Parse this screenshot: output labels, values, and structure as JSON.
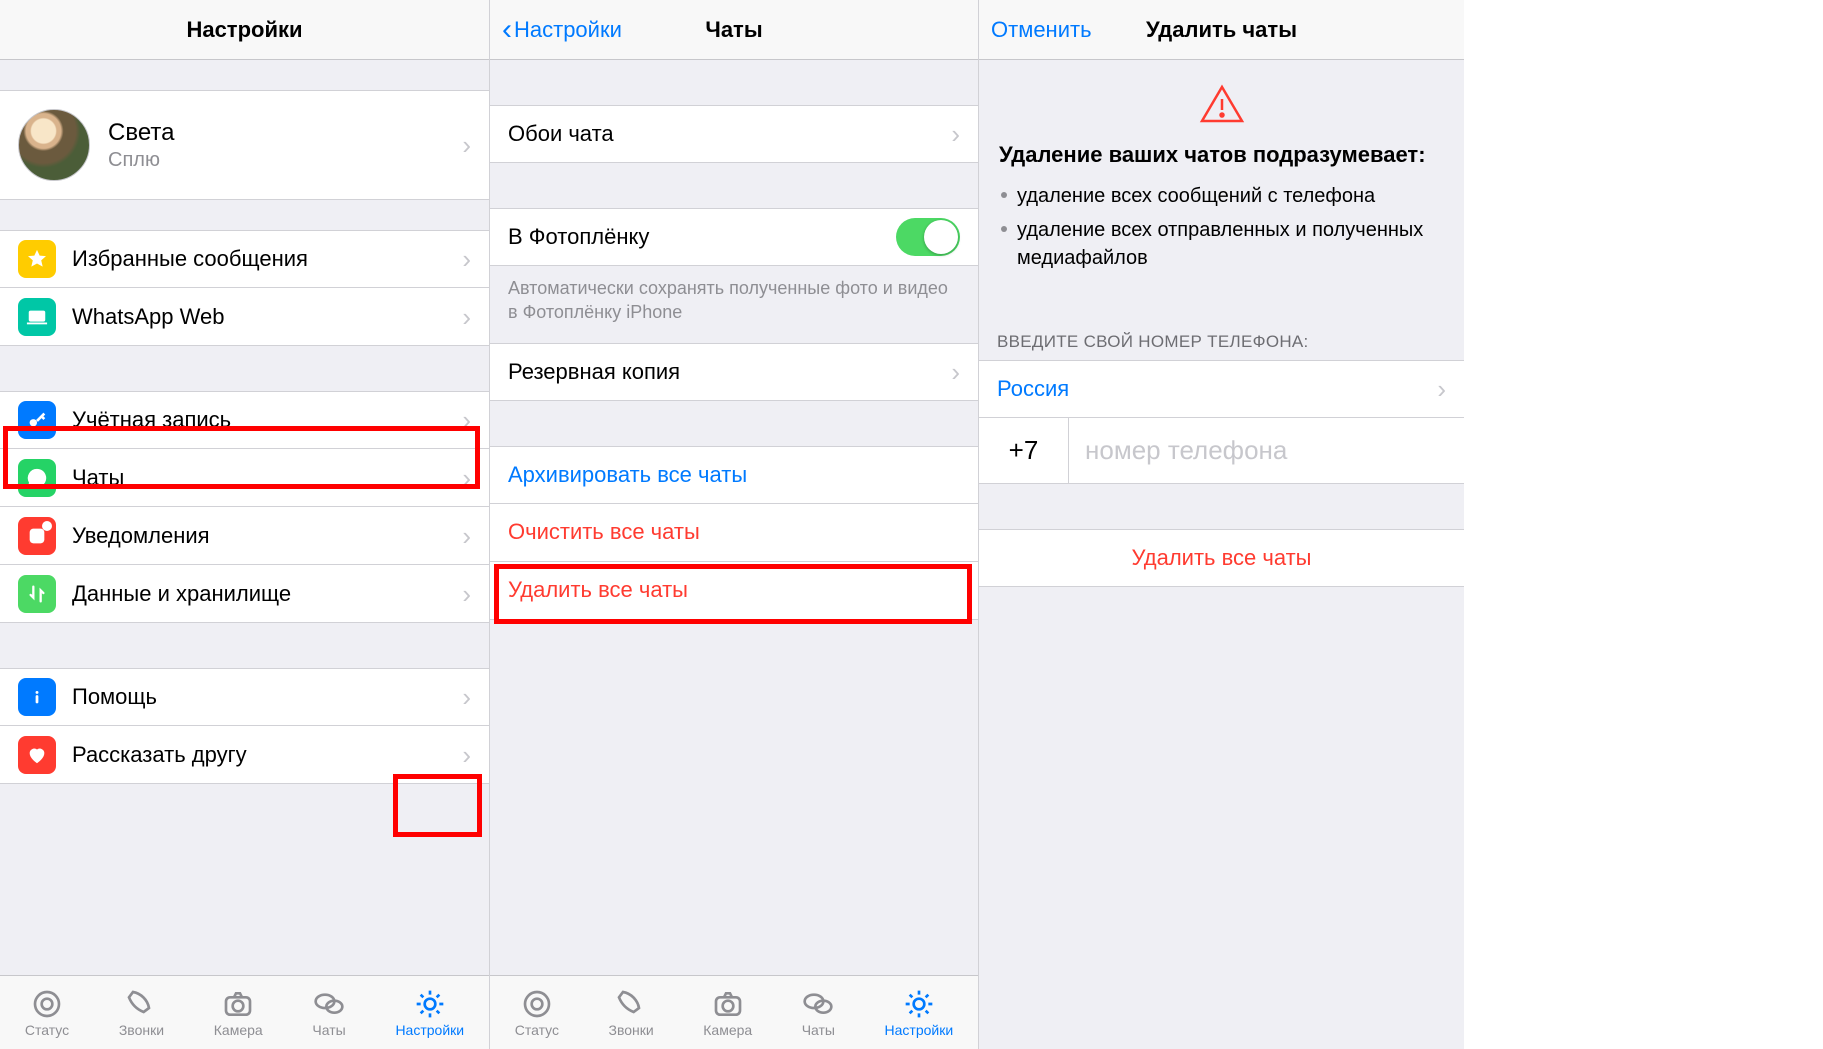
{
  "panel1": {
    "nav_title": "Настройки",
    "profile": {
      "name": "Света",
      "status": "Сплю"
    },
    "rows": {
      "starred": "Избранные сообщения",
      "web": "WhatsApp Web",
      "account": "Учётная запись",
      "chats": "Чаты",
      "notifications": "Уведомления",
      "data": "Данные и хранилище",
      "help": "Помощь",
      "tell": "Рассказать другу"
    }
  },
  "panel2": {
    "back": "Настройки",
    "title": "Чаты",
    "rows": {
      "wallpaper": "Обои чата",
      "camera_roll": "В Фотоплёнку",
      "camera_roll_footer": "Автоматически сохранять полученные фото и видео в Фотоплёнку iPhone",
      "backup": "Резервная копия",
      "archive_all": "Архивировать все чаты",
      "clear_all": "Очистить все чаты",
      "delete_all": "Удалить все чаты"
    }
  },
  "panel3": {
    "cancel": "Отменить",
    "title": "Удалить чаты",
    "heading": "Удаление ваших чатов подразумевает:",
    "bullet1": "удаление всех сообщений с телефона",
    "bullet2": "удаление всех отправленных и полученных медиафайлов",
    "enter_phone_header": "ВВЕДИТЕ СВОЙ НОМЕР ТЕЛЕФОНА:",
    "country": "Россия",
    "prefix": "+7",
    "phone_placeholder": "номер телефона",
    "delete_all": "Удалить все чаты"
  },
  "tabs": {
    "status": "Статус",
    "calls": "Звонки",
    "camera": "Камера",
    "chats": "Чаты",
    "settings": "Настройки"
  }
}
